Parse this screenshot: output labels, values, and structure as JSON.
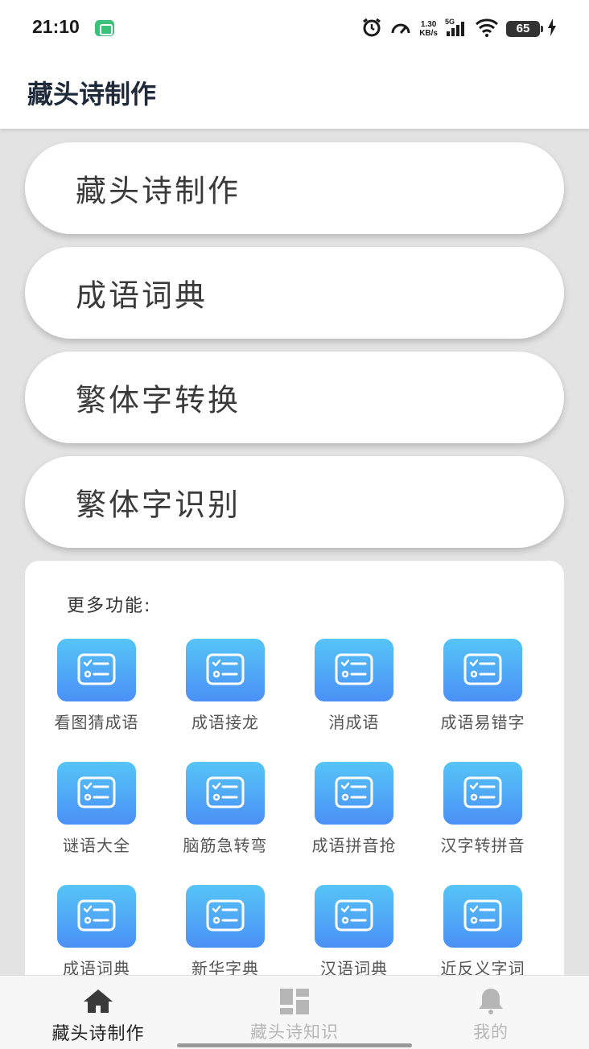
{
  "status_bar": {
    "time": "21:10",
    "net_speed_top": "1.30",
    "net_speed_bottom": "KB/s",
    "network": "5G",
    "battery": "65"
  },
  "header": {
    "title": "藏头诗制作"
  },
  "main_buttons": [
    {
      "label": "藏头诗制作"
    },
    {
      "label": "成语词典"
    },
    {
      "label": "繁体字转换"
    },
    {
      "label": "繁体字识别"
    }
  ],
  "more": {
    "title": "更多功能:",
    "items": [
      {
        "label": "看图猜成语",
        "icon": "list-check-icon"
      },
      {
        "label": "成语接龙",
        "icon": "list-check-icon"
      },
      {
        "label": "消成语",
        "icon": "list-check-icon"
      },
      {
        "label": "成语易错字",
        "icon": "list-check-icon"
      },
      {
        "label": "谜语大全",
        "icon": "list-check-icon"
      },
      {
        "label": "脑筋急转弯",
        "icon": "list-check-icon"
      },
      {
        "label": "成语拼音抢",
        "icon": "list-check-icon"
      },
      {
        "label": "汉字转拼音",
        "icon": "list-check-icon"
      },
      {
        "label": "成语词典",
        "icon": "list-check-icon"
      },
      {
        "label": "新华字典",
        "icon": "list-check-icon"
      },
      {
        "label": "汉语词典",
        "icon": "list-check-icon"
      },
      {
        "label": "近反义字词",
        "icon": "list-check-icon"
      }
    ],
    "icon_gradient": [
      "#56c5f7",
      "#4a90f5"
    ]
  },
  "bottom_nav": [
    {
      "label": "藏头诗制作",
      "icon": "home-icon",
      "active": true
    },
    {
      "label": "藏头诗知识",
      "icon": "dashboard-icon",
      "active": false
    },
    {
      "label": "我的",
      "icon": "bell-icon",
      "active": false
    }
  ]
}
